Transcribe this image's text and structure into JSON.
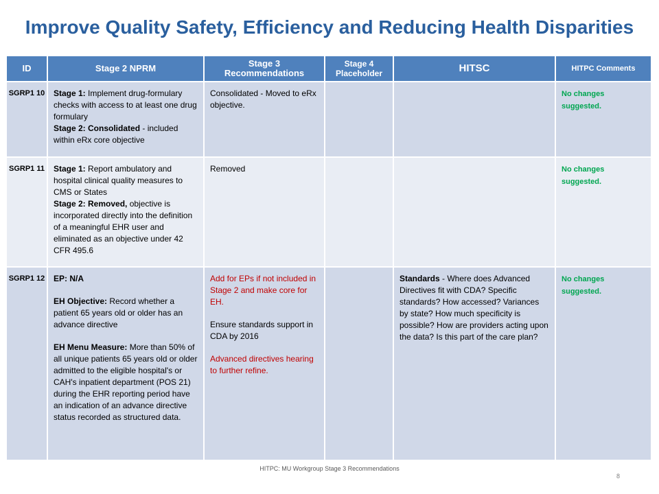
{
  "title": "Improve Quality Safety, Efficiency and Reducing Health Disparities",
  "table": {
    "headers": [
      "ID",
      "Stage 2 NPRM",
      "Stage 3 Recommendations",
      "Stage 4 Placeholder",
      "HITSC",
      "HITPC Comments"
    ],
    "rows": [
      {
        "id": "SGRP1 10",
        "stage2": {
          "s1_label": "Stage 1:",
          "s1_text": " Implement drug-formulary checks with access to at least one drug formulary",
          "s2_label": "Stage 2: Consolidated",
          "s2_text": " - included within eRx core objective"
        },
        "stage3": "Consolidated - Moved to eRx objective.",
        "stage4": "",
        "hitsc": "",
        "comments": "No changes suggested."
      },
      {
        "id": "SGRP1 11",
        "stage2": {
          "s1_label": "Stage 1:",
          "s1_text": " Report ambulatory and hospital clinical quality measures to CMS or States",
          "s2_label": "Stage 2: Removed,",
          "s2_text": " objective is incorporated directly into the definition of a meaningful EHR user and eliminated as an objective under 42 CFR 495.6"
        },
        "stage3": "Removed",
        "stage4": "",
        "hitsc": "",
        "comments": "No changes suggested."
      },
      {
        "id": "SGRP1 12",
        "stage2": {
          "ep": "EP: N/A",
          "eh_label": "EH Objective:",
          "eh_text": " Record whether a patient 65 years old or older has an advance directive",
          "menu_label": "EH Menu Measure:",
          "menu_text": " More than 50% of all unique patients 65 years old or older admitted to the eligible hospital's or CAH's inpatient department (POS 21) during the EHR reporting period have an indication of an advance directive status recorded as structured data."
        },
        "stage3": {
          "p1": "Add for EPs if not included in Stage 2 and make core for EH.",
          "p2": "Ensure standards support in CDA by 2016",
          "p3": "Advanced directives hearing to further refine."
        },
        "stage4": "",
        "hitsc": {
          "label": "Standards",
          "text": " - Where does Advanced Directives fit with CDA? Specific standards? How accessed? Variances by state? How much specificity is possible? How are providers acting upon the data? Is this part of the care plan?"
        },
        "comments": "No changes suggested."
      }
    ]
  },
  "footer": "HITPC: MU Workgroup Stage 3 Recommendations",
  "page_number": "8",
  "colors": {
    "title": "#2a5f9e",
    "header_bg": "#4f81bd",
    "row_dark": "#d0d8e8",
    "row_light": "#e9edf4",
    "red": "#c00000",
    "green": "#00a650"
  }
}
